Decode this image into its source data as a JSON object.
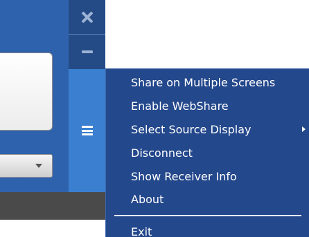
{
  "window": {
    "controls": {
      "close_icon": "close-icon",
      "minimize_icon": "minimize-icon",
      "menu_icon": "hamburger-menu-icon"
    }
  },
  "menu": {
    "items": [
      {
        "label": "Share on Multiple Screens"
      },
      {
        "label": "Enable WebShare"
      },
      {
        "label": "Select Source Display",
        "has_submenu": true
      },
      {
        "label": "Disconnect"
      },
      {
        "label": "Show Receiver Info"
      },
      {
        "label": "About"
      },
      {
        "label": "Exit"
      }
    ]
  },
  "colors": {
    "menu_background": "#24488c",
    "window_background": "#2f62ad",
    "control_strip": "#3a7fd0",
    "control_button": "#254b86",
    "footer": "#4a4a4a",
    "menu_text": "#ffffff"
  }
}
